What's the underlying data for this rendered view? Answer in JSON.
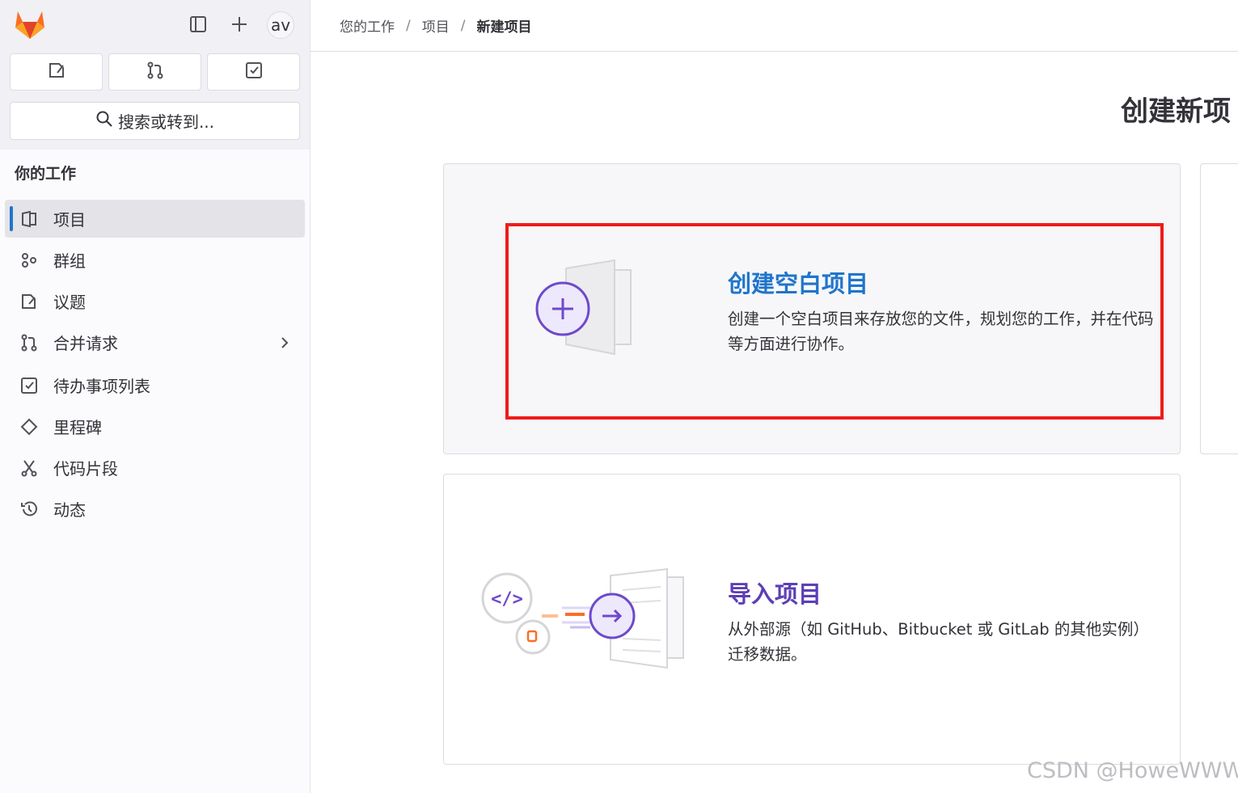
{
  "sidebar": {
    "avatar_initials": "av",
    "search_placeholder": "搜索或转到...",
    "section_title": "你的工作",
    "items": [
      {
        "label": "项目",
        "icon": "project-icon",
        "active": true
      },
      {
        "label": "群组",
        "icon": "group-icon"
      },
      {
        "label": "议题",
        "icon": "issues-icon"
      },
      {
        "label": "合并请求",
        "icon": "merge-request-icon",
        "has_chevron": true
      },
      {
        "label": "待办事项列表",
        "icon": "todo-icon"
      },
      {
        "label": "里程碑",
        "icon": "milestone-icon"
      },
      {
        "label": "代码片段",
        "icon": "snippet-icon"
      },
      {
        "label": "动态",
        "icon": "history-icon"
      }
    ]
  },
  "breadcrumb": [
    "您的工作",
    "项目",
    "新建项目"
  ],
  "main": {
    "title": "创建新项",
    "blank_project": {
      "title": "创建空白项目",
      "description": "创建一个空白项目来存放您的文件，规划您的工作，并在代码等方面进行协作。"
    },
    "import_project": {
      "title": "导入项目",
      "description": "从外部源（如 GitHub、Bitbucket 或 GitLab 的其他实例）迁移数据。"
    }
  },
  "watermark": "CSDN @HoweWWW",
  "colors": {
    "accent_blue": "#1f75cb",
    "accent_purple": "#5c3fb5",
    "highlight_red": "#ee1c1c",
    "gitlab_orange": "#fc6d26"
  }
}
